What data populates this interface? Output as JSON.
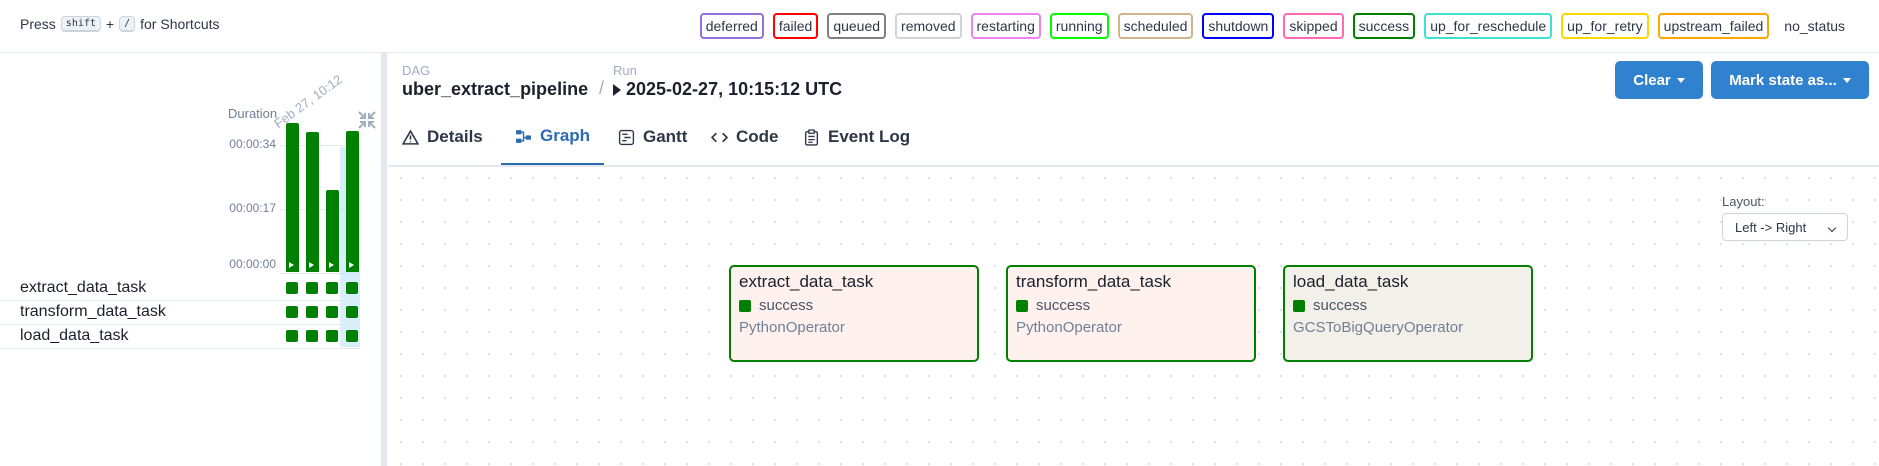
{
  "shortcut": {
    "press": "Press",
    "key1": "shift",
    "plus": "+",
    "key2": "/",
    "suffix": "for Shortcuts"
  },
  "legend": [
    {
      "label": "deferred",
      "color": "#9370DB"
    },
    {
      "label": "failed",
      "color": "#FF0000"
    },
    {
      "label": "queued",
      "color": "#808080"
    },
    {
      "label": "removed",
      "color": "#D3D3D3"
    },
    {
      "label": "restarting",
      "color": "#EE82EE"
    },
    {
      "label": "running",
      "color": "#00FF00"
    },
    {
      "label": "scheduled",
      "color": "#D2B48C"
    },
    {
      "label": "shutdown",
      "color": "#0000FF"
    },
    {
      "label": "skipped",
      "color": "#FF69B4"
    },
    {
      "label": "success",
      "color": "#008000"
    },
    {
      "label": "up_for_reschedule",
      "color": "#40E0D0"
    },
    {
      "label": "up_for_retry",
      "color": "#FFD700"
    },
    {
      "label": "upstream_failed",
      "color": "#FFA500"
    },
    {
      "label": "no_status",
      "color": ""
    }
  ],
  "grid": {
    "duration_label": "Duration",
    "date_label": "Feb 27, 10:12",
    "ticks": [
      "00:00:34",
      "00:00:17",
      "00:00:00"
    ],
    "run_durations_fraction": [
      0.98,
      0.92,
      0.54,
      0.93
    ],
    "tasks": [
      {
        "name": "extract_data_task",
        "states": [
          "success",
          "success",
          "success",
          "success"
        ]
      },
      {
        "name": "transform_data_task",
        "states": [
          "success",
          "success",
          "success",
          "success"
        ]
      },
      {
        "name": "load_data_task",
        "states": [
          "success",
          "success",
          "success",
          "success"
        ]
      }
    ]
  },
  "header": {
    "dag_label": "DAG",
    "dag_id": "uber_extract_pipeline",
    "separator": "/",
    "run_label": "Run",
    "run_id": "2025-02-27, 10:15:12 UTC",
    "clear_button": "Clear",
    "mark_button": "Mark state as..."
  },
  "tabs": [
    {
      "label": "Details",
      "icon": "warning-icon"
    },
    {
      "label": "Graph",
      "icon": "graph-icon",
      "active": true
    },
    {
      "label": "Gantt",
      "icon": "gantt-icon"
    },
    {
      "label": "Code",
      "icon": "code-icon"
    },
    {
      "label": "Event Log",
      "icon": "clipboard-icon"
    }
  ],
  "graph": {
    "layout_label": "Layout:",
    "layout_value": "Left -> Right",
    "nodes": [
      {
        "name": "extract_data_task",
        "state": "success",
        "operator": "PythonOperator",
        "bg": "#FFF1EE"
      },
      {
        "name": "transform_data_task",
        "state": "success",
        "operator": "PythonOperator",
        "bg": "#FFF1EE"
      },
      {
        "name": "load_data_task",
        "state": "success",
        "operator": "GCSToBigQueryOperator",
        "bg": "#F2F0E8"
      }
    ]
  }
}
